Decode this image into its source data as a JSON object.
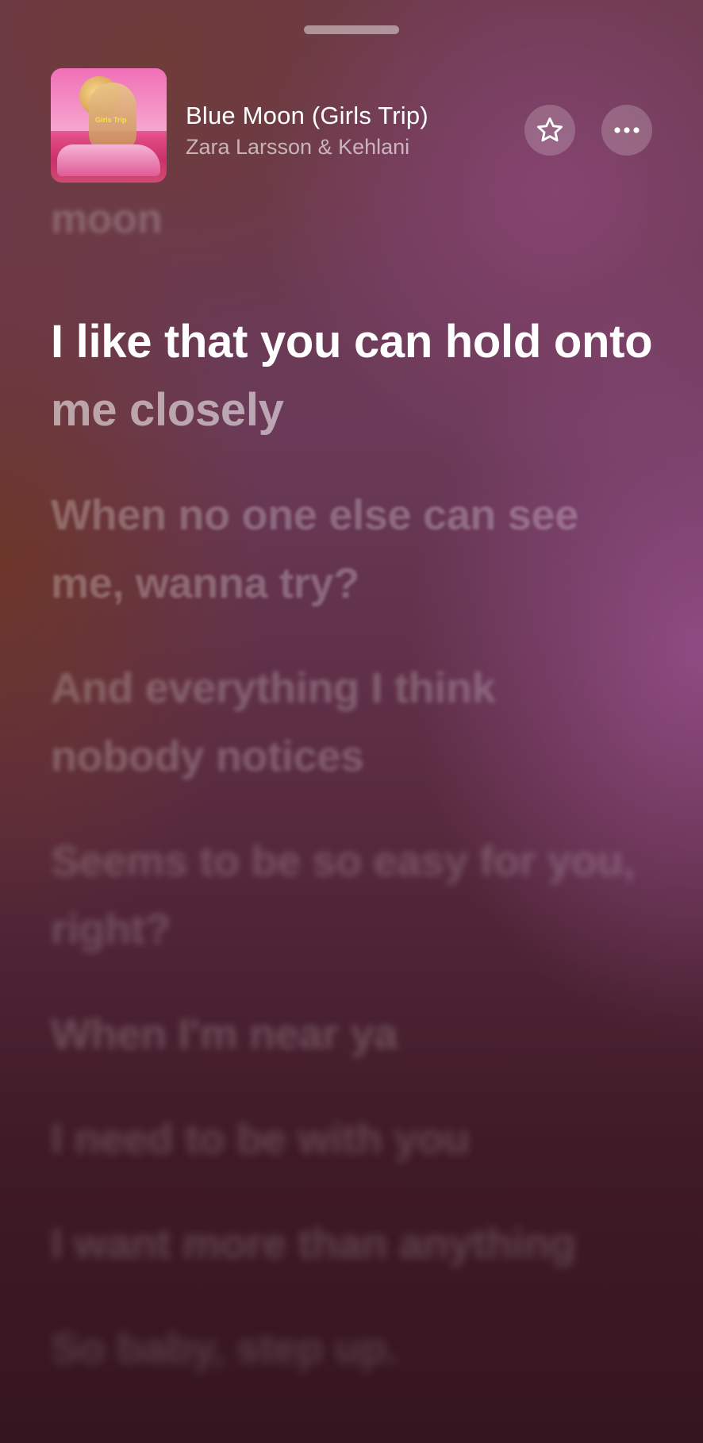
{
  "header": {
    "title": "Blue Moon (Girls Trip)",
    "artist": "Zara Larsson & Kehlani",
    "artwork_tag": "Girls Trip",
    "favorite_icon": "star-icon",
    "more_icon": "ellipsis-icon"
  },
  "lyrics": {
    "previous_line": "moon",
    "current_line": {
      "sung": "I like that you can hold onto",
      "unsung": "me closely"
    },
    "upcoming": [
      "When no one else can see me, wanna try?",
      "And everything I think nobody notices",
      "Seems to be so easy for you, right?",
      "When I'm near ya",
      "I need to be with you",
      "I want more than anything",
      "So baby, step up."
    ]
  },
  "colors": {
    "text_active": "#ffffff",
    "text_dim": "rgba(255,255,255,0.55)",
    "button_bg": "rgba(255,255,255,0.2)"
  }
}
